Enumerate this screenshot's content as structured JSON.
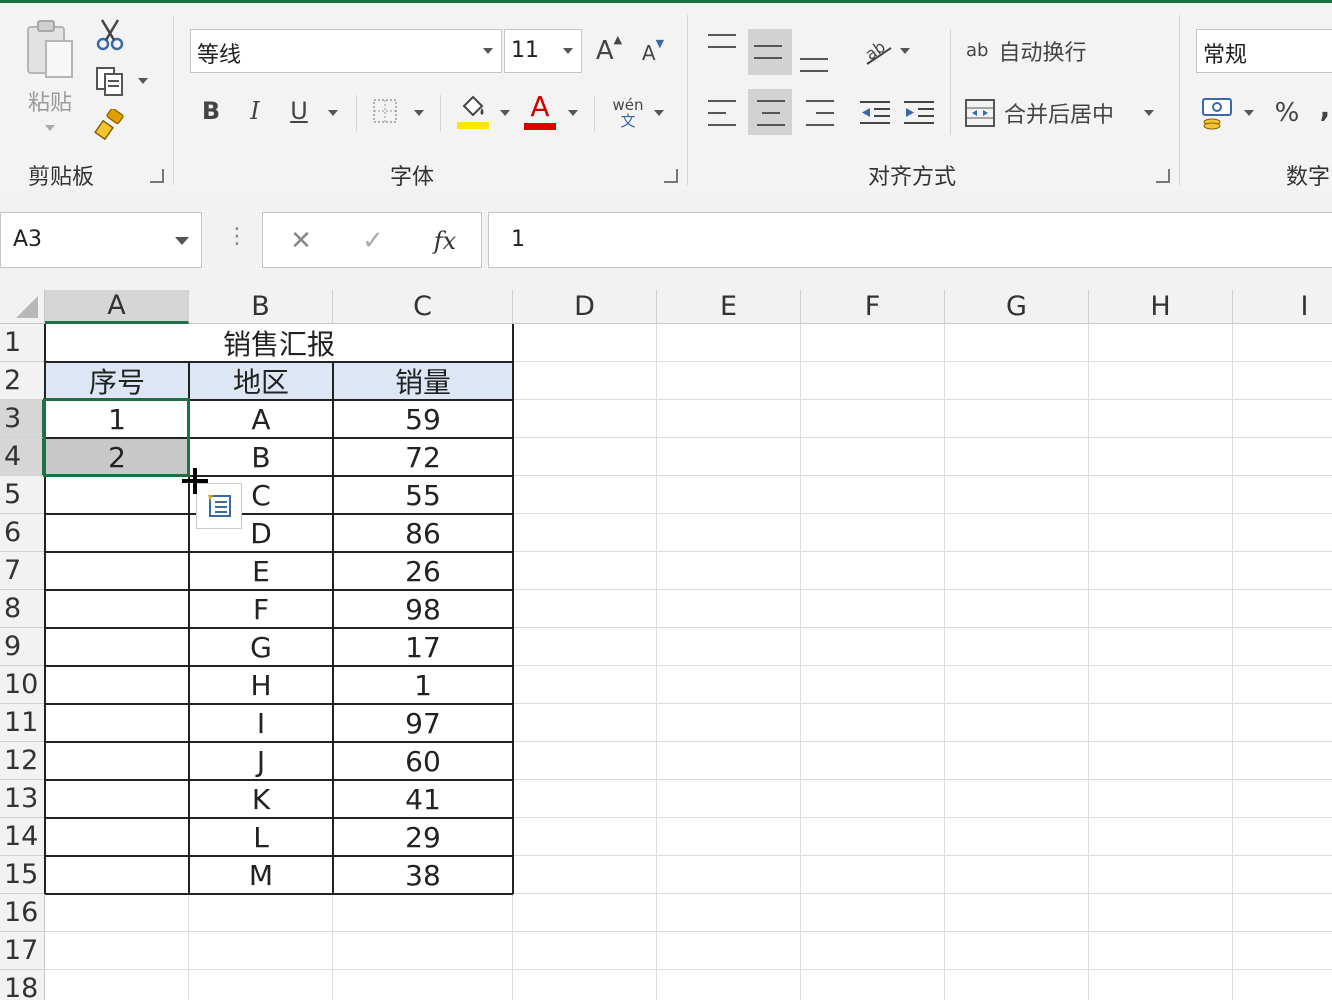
{
  "ribbon": {
    "clipboard": {
      "group_label": "剪贴板",
      "paste_label": "粘贴"
    },
    "font": {
      "group_label": "字体",
      "font_name": "等线",
      "font_size": "11",
      "bold": "B",
      "italic": "I",
      "underline": "U",
      "grow_font": "A",
      "shrink_font": "A",
      "phonetic": "wén",
      "phonetic_sub": "文",
      "font_color": "A",
      "fill_color_hex": "#ffe600",
      "font_color_hex": "#e00000"
    },
    "alignment": {
      "group_label": "对齐方式",
      "wrap_text": "自动换行",
      "merge_center": "合并后居中",
      "wrap_icon": "ab"
    },
    "number": {
      "group_label": "数字",
      "format": "常规",
      "percent": "%",
      "comma": ","
    }
  },
  "formula_bar": {
    "name_box": "A3",
    "fx": "fx",
    "value": "1"
  },
  "sheet": {
    "columns": [
      "A",
      "B",
      "C",
      "D",
      "E",
      "F",
      "G",
      "H",
      "I"
    ],
    "rows": [
      "1",
      "2",
      "3",
      "4",
      "5",
      "6",
      "7",
      "8",
      "9",
      "10",
      "11",
      "12",
      "13",
      "14",
      "15",
      "16",
      "17",
      "18"
    ],
    "title": "销售汇报",
    "headers": [
      "序号",
      "地区",
      "销量"
    ],
    "seq": [
      "1",
      "2"
    ],
    "regions": [
      "A",
      "B",
      "C",
      "D",
      "E",
      "F",
      "G",
      "H",
      "I",
      "J",
      "K",
      "L",
      "M"
    ],
    "sales": [
      "59",
      "72",
      "55",
      "86",
      "26",
      "98",
      "17",
      "1",
      "97",
      "60",
      "41",
      "29",
      "38"
    ],
    "header_fill_hex": "#dce6f4",
    "selection_hex": "#1e7145"
  }
}
